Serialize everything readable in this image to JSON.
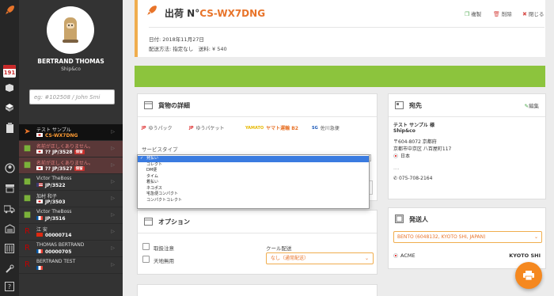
{
  "rail": {
    "logo_icon": "rocket-icon",
    "calendar_number": "191",
    "icons": [
      "rocket-icon",
      "calendar-icon",
      "package-icon",
      "box-icon",
      "clipboard-icon",
      "user-icon",
      "store-icon",
      "truck-icon",
      "warehouse-icon",
      "settings-sliders-icon",
      "help-icon"
    ]
  },
  "sidebar": {
    "user_name": "BERTRAND THOMAS",
    "company": "Ship&co",
    "search_placeholder": "eg: #102508 / John Smi",
    "shipments": [
      {
        "line1": "テスト サンプル",
        "line2": "CS-WX7DNG",
        "flag": "jp",
        "state": "active",
        "badge": ""
      },
      {
        "line1": "名前が正しくありません。",
        "line2": "?? JP/3528",
        "flag": "jp",
        "state": "error",
        "badge": "保留"
      },
      {
        "line1": "名前が正しくありません。",
        "line2": "?? JP/3527",
        "flag": "jp",
        "state": "error",
        "badge": "保留"
      },
      {
        "line1": "Victor TheBoss",
        "line2": "JP/3522",
        "flag": "us",
        "state": "normal",
        "badge": ""
      },
      {
        "line1": "加村 和子",
        "line2": "JP/3503",
        "flag": "jp",
        "state": "normal",
        "badge": ""
      },
      {
        "line1": "Victor TheBoss",
        "line2": "JP/3516",
        "flag": "fr",
        "state": "normal",
        "badge": ""
      },
      {
        "line1": "江 安",
        "line2": "00000714",
        "flag": "cn",
        "state": "normal",
        "badge": ""
      },
      {
        "line1": "THOMAS BERTRAND",
        "line2": "00000705",
        "flag": "fr",
        "state": "normal",
        "badge": ""
      },
      {
        "line1": "BERTRAND TEST",
        "line2": "",
        "flag": "fr",
        "state": "normal",
        "badge": ""
      }
    ]
  },
  "header": {
    "title_prefix": "出荷 N°",
    "shipment_code": "CS-WX7DNG",
    "actions": {
      "copy": "複製",
      "delete": "削除",
      "close": "閉じる"
    },
    "date": "日付: 2018年11月27日",
    "delivery": "配送方法: 指定なし",
    "postage": "送料: ¥ 540"
  },
  "status_bar_color": "#8cc43d",
  "cargo": {
    "title": "貨物の詳細",
    "carriers": [
      {
        "logo": "JP",
        "name": "ゆうパック"
      },
      {
        "logo": "JP",
        "name": "ゆうパケット"
      },
      {
        "logo": "YAMATO",
        "name": "ヤマト運輸 B2"
      },
      {
        "logo": "SG",
        "name": "佐川急便"
      }
    ],
    "service_type_label": "サービスタイプ",
    "service_options": [
      "発払い",
      "コレクト",
      "DM便",
      "タイム",
      "着払い",
      "ネコポス",
      "宅急便コンパクト",
      "コンパクトコレクト"
    ],
    "selected_service": "発払い"
  },
  "options": {
    "title": "オプション",
    "checkboxes": [
      "取扱注意",
      "天地無用"
    ],
    "cool_label": "クール配送",
    "cool_value": "なし（通常配送）"
  },
  "destination": {
    "title": "宛先",
    "edit_label": "編集",
    "name": "テスト サンプル 様",
    "company": "Ship&co",
    "postal": "〒604-8072 京都府",
    "address": "京都市中京区 八百屋町117",
    "country": "日本",
    "dots": "....",
    "phone": "075-708-2164"
  },
  "sender": {
    "title": "発送人",
    "selected": "BENTO (6048132, KYOTO SHI, JAPAN)",
    "name": "ACME",
    "city": "KYOTO SHI"
  },
  "accent_color": "#e8742a"
}
